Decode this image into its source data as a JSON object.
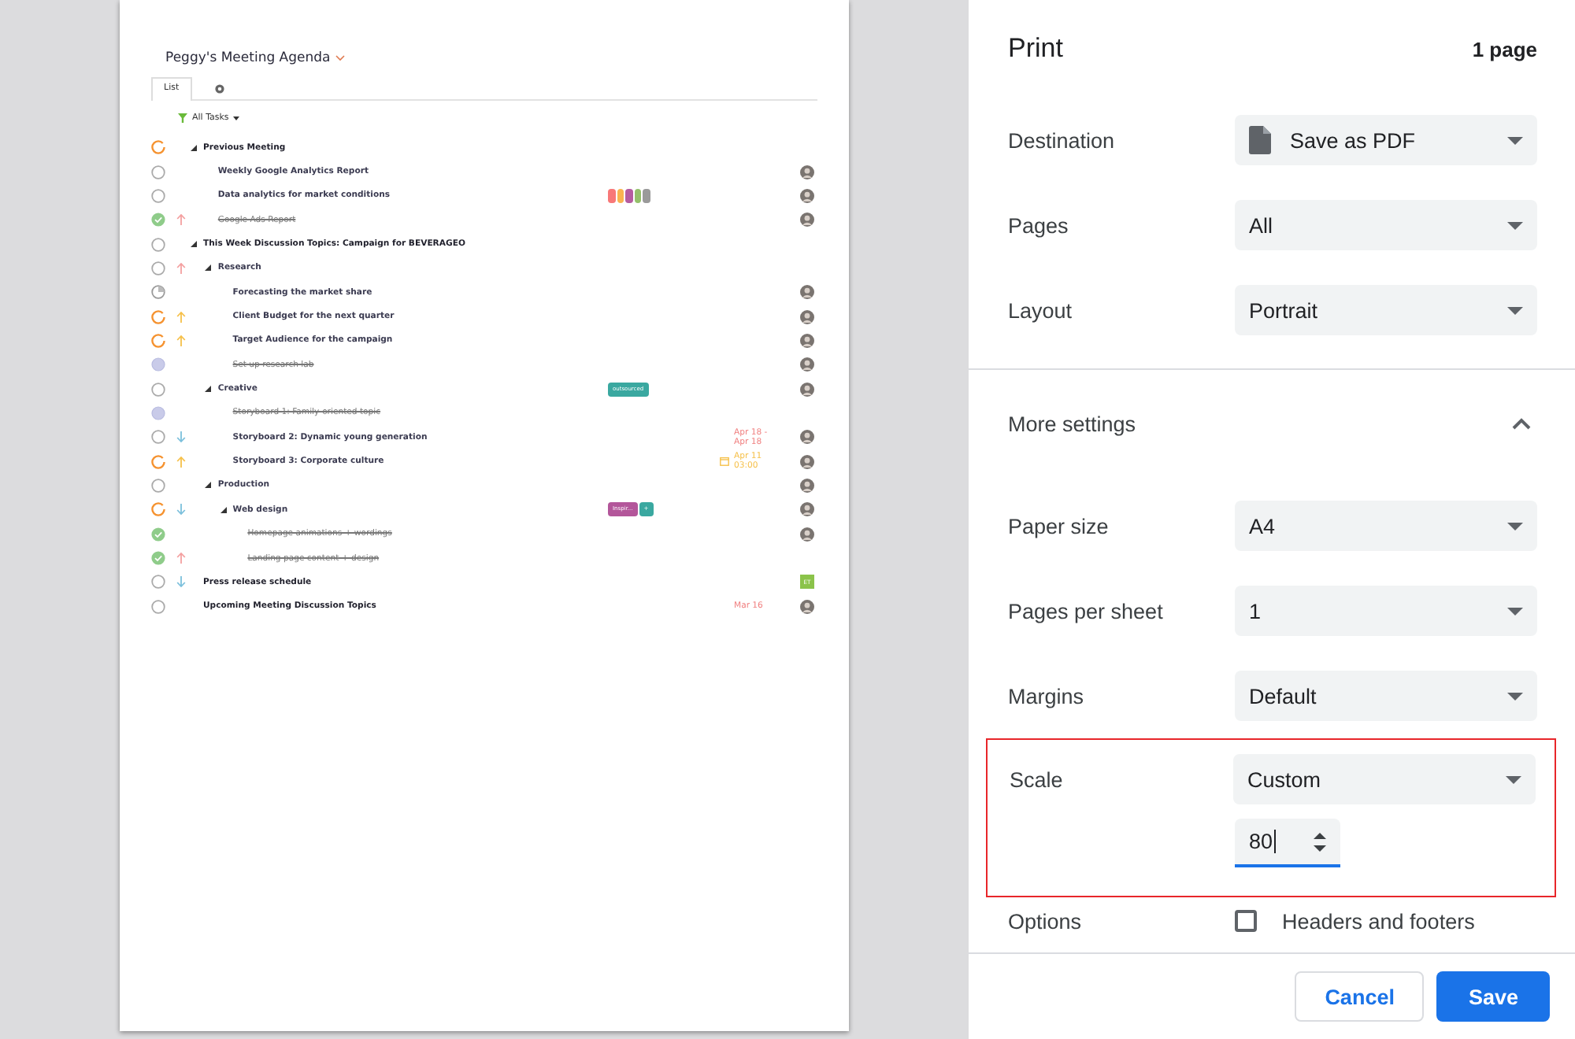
{
  "preview": {
    "title": "Peggy's Meeting Agenda",
    "tabs": [
      {
        "kind": "text",
        "label": "List",
        "selected": true
      },
      {
        "kind": "gear",
        "selected": false
      }
    ],
    "filter": "All Tasks",
    "tasks": [
      {
        "name": "Previous Meeting",
        "status": {
          "kind": "progress"
        },
        "children": [
          {
            "name": "Weekly Google Analytics Report",
            "status": {
              "kind": "open"
            },
            "avatar": {
              "kind": "photo"
            }
          },
          {
            "name": "Data analytics for market conditions",
            "status": {
              "kind": "open"
            },
            "tags": [
              {
                "color": "#f87878"
              },
              {
                "color": "#f9b450"
              },
              {
                "color": "#b55ca0"
              },
              {
                "color": "#94c06a"
              },
              {
                "color": "#9a9a9a"
              }
            ],
            "avatar": {
              "kind": "photo"
            }
          },
          {
            "name": "Google Ads Report",
            "status": {
              "kind": "done"
            },
            "priority": {
              "kind": "high"
            },
            "avatar": {
              "kind": "photo"
            }
          }
        ]
      },
      {
        "name": "This Week Discussion Topics: Campaign for BEVERAGEO",
        "status": {
          "kind": "open"
        },
        "children": [
          {
            "name": "Research",
            "status": {
              "kind": "open"
            },
            "priority": {
              "kind": "high"
            },
            "children": [
              {
                "name": "Forecasting the market share",
                "status": {
                  "kind": "quarter"
                },
                "avatar": {
                  "kind": "photo"
                }
              },
              {
                "name": "Client Budget for the next quarter",
                "status": {
                  "kind": "progress"
                },
                "priority": {
                  "kind": "medium"
                },
                "avatar": {
                  "kind": "photo"
                }
              },
              {
                "name": "Target Audience for the campaign",
                "status": {
                  "kind": "progress"
                },
                "priority": {
                  "kind": "medium"
                },
                "avatar": {
                  "kind": "photo"
                }
              },
              {
                "name": "Set up research lab",
                "status": {
                  "kind": "blocked"
                },
                "avatar": {
                  "kind": "photo"
                }
              }
            ]
          },
          {
            "name": "Creative",
            "status": {
              "kind": "open"
            },
            "tags": [
              {
                "text": "outsourced",
                "color": "#3aa8a0"
              }
            ],
            "avatar": {
              "kind": "photo"
            },
            "children": [
              {
                "name": "Storyboard 1: Family-oriented topic",
                "status": {
                  "kind": "blocked"
                }
              },
              {
                "name": "Storyboard 2: Dynamic young generation",
                "status": {
                  "kind": "open"
                },
                "priority": {
                  "kind": "low"
                },
                "date": {
                  "kind": "due",
                  "text": "Apr 18 - Apr 18",
                  "color": "#f07f7f"
                },
                "avatar": {
                  "kind": "photo"
                }
              },
              {
                "name": "Storyboard 3: Corporate culture",
                "status": {
                  "kind": "progress"
                },
                "priority": {
                  "kind": "medium"
                },
                "date": {
                  "kind": "scheduled",
                  "text": "Apr 11 03:00",
                  "color": "#f6c04a"
                },
                "avatar": {
                  "kind": "photo"
                }
              }
            ]
          },
          {
            "name": "Production",
            "status": {
              "kind": "open"
            },
            "avatar": {
              "kind": "photo"
            },
            "children": [
              {
                "name": "Web design",
                "status": {
                  "kind": "progress"
                },
                "priority": {
                  "kind": "low"
                },
                "tags": [
                  {
                    "text": "Inspir...",
                    "color": "#b3569a"
                  },
                  {
                    "text": "+",
                    "color": "#3aa8a0"
                  }
                ],
                "avatar": {
                  "kind": "photo"
                },
                "children": [
                  {
                    "name": "Homepage animations + wordings",
                    "status": {
                      "kind": "done"
                    },
                    "avatar": {
                      "kind": "photo"
                    }
                  },
                  {
                    "name": "Landing page content + design",
                    "status": {
                      "kind": "done"
                    },
                    "priority": {
                      "kind": "high"
                    }
                  }
                ]
              }
            ]
          }
        ]
      },
      {
        "name": "Press release schedule",
        "status": {
          "kind": "open"
        },
        "priority": {
          "kind": "low"
        },
        "avatar": {
          "kind": "initials",
          "text": "ET",
          "color": "#8bc34a"
        }
      },
      {
        "name": "Upcoming Meeting Discussion Topics",
        "status": {
          "kind": "open"
        },
        "date": {
          "kind": "due",
          "text": "Mar 16",
          "color": "#f07f7f"
        },
        "avatar": {
          "kind": "photo"
        }
      }
    ]
  },
  "print": {
    "title": "Print",
    "page_count": "1 page",
    "settings": [
      {
        "kind": "select",
        "label": "Destination",
        "value": "Save as PDF",
        "doc_icon": true
      },
      {
        "kind": "select",
        "label": "Pages",
        "value": "All"
      },
      {
        "kind": "select",
        "label": "Layout",
        "value": "Portrait"
      }
    ],
    "more_settings": {
      "label": "More settings",
      "expanded": true
    },
    "advanced": [
      {
        "kind": "select",
        "label": "Paper size",
        "value": "A4"
      },
      {
        "kind": "select",
        "label": "Pages per sheet",
        "value": "1"
      },
      {
        "kind": "select",
        "label": "Margins",
        "value": "Default"
      },
      {
        "kind": "scale",
        "label": "Scale",
        "value": "Custom",
        "number": "80",
        "highlighted": true
      },
      {
        "kind": "checkbox",
        "label": "Options",
        "option": "Headers and footers",
        "checked": false
      }
    ],
    "buttons": [
      {
        "kind": "secondary",
        "label": "Cancel"
      },
      {
        "kind": "primary",
        "label": "Save"
      }
    ]
  }
}
